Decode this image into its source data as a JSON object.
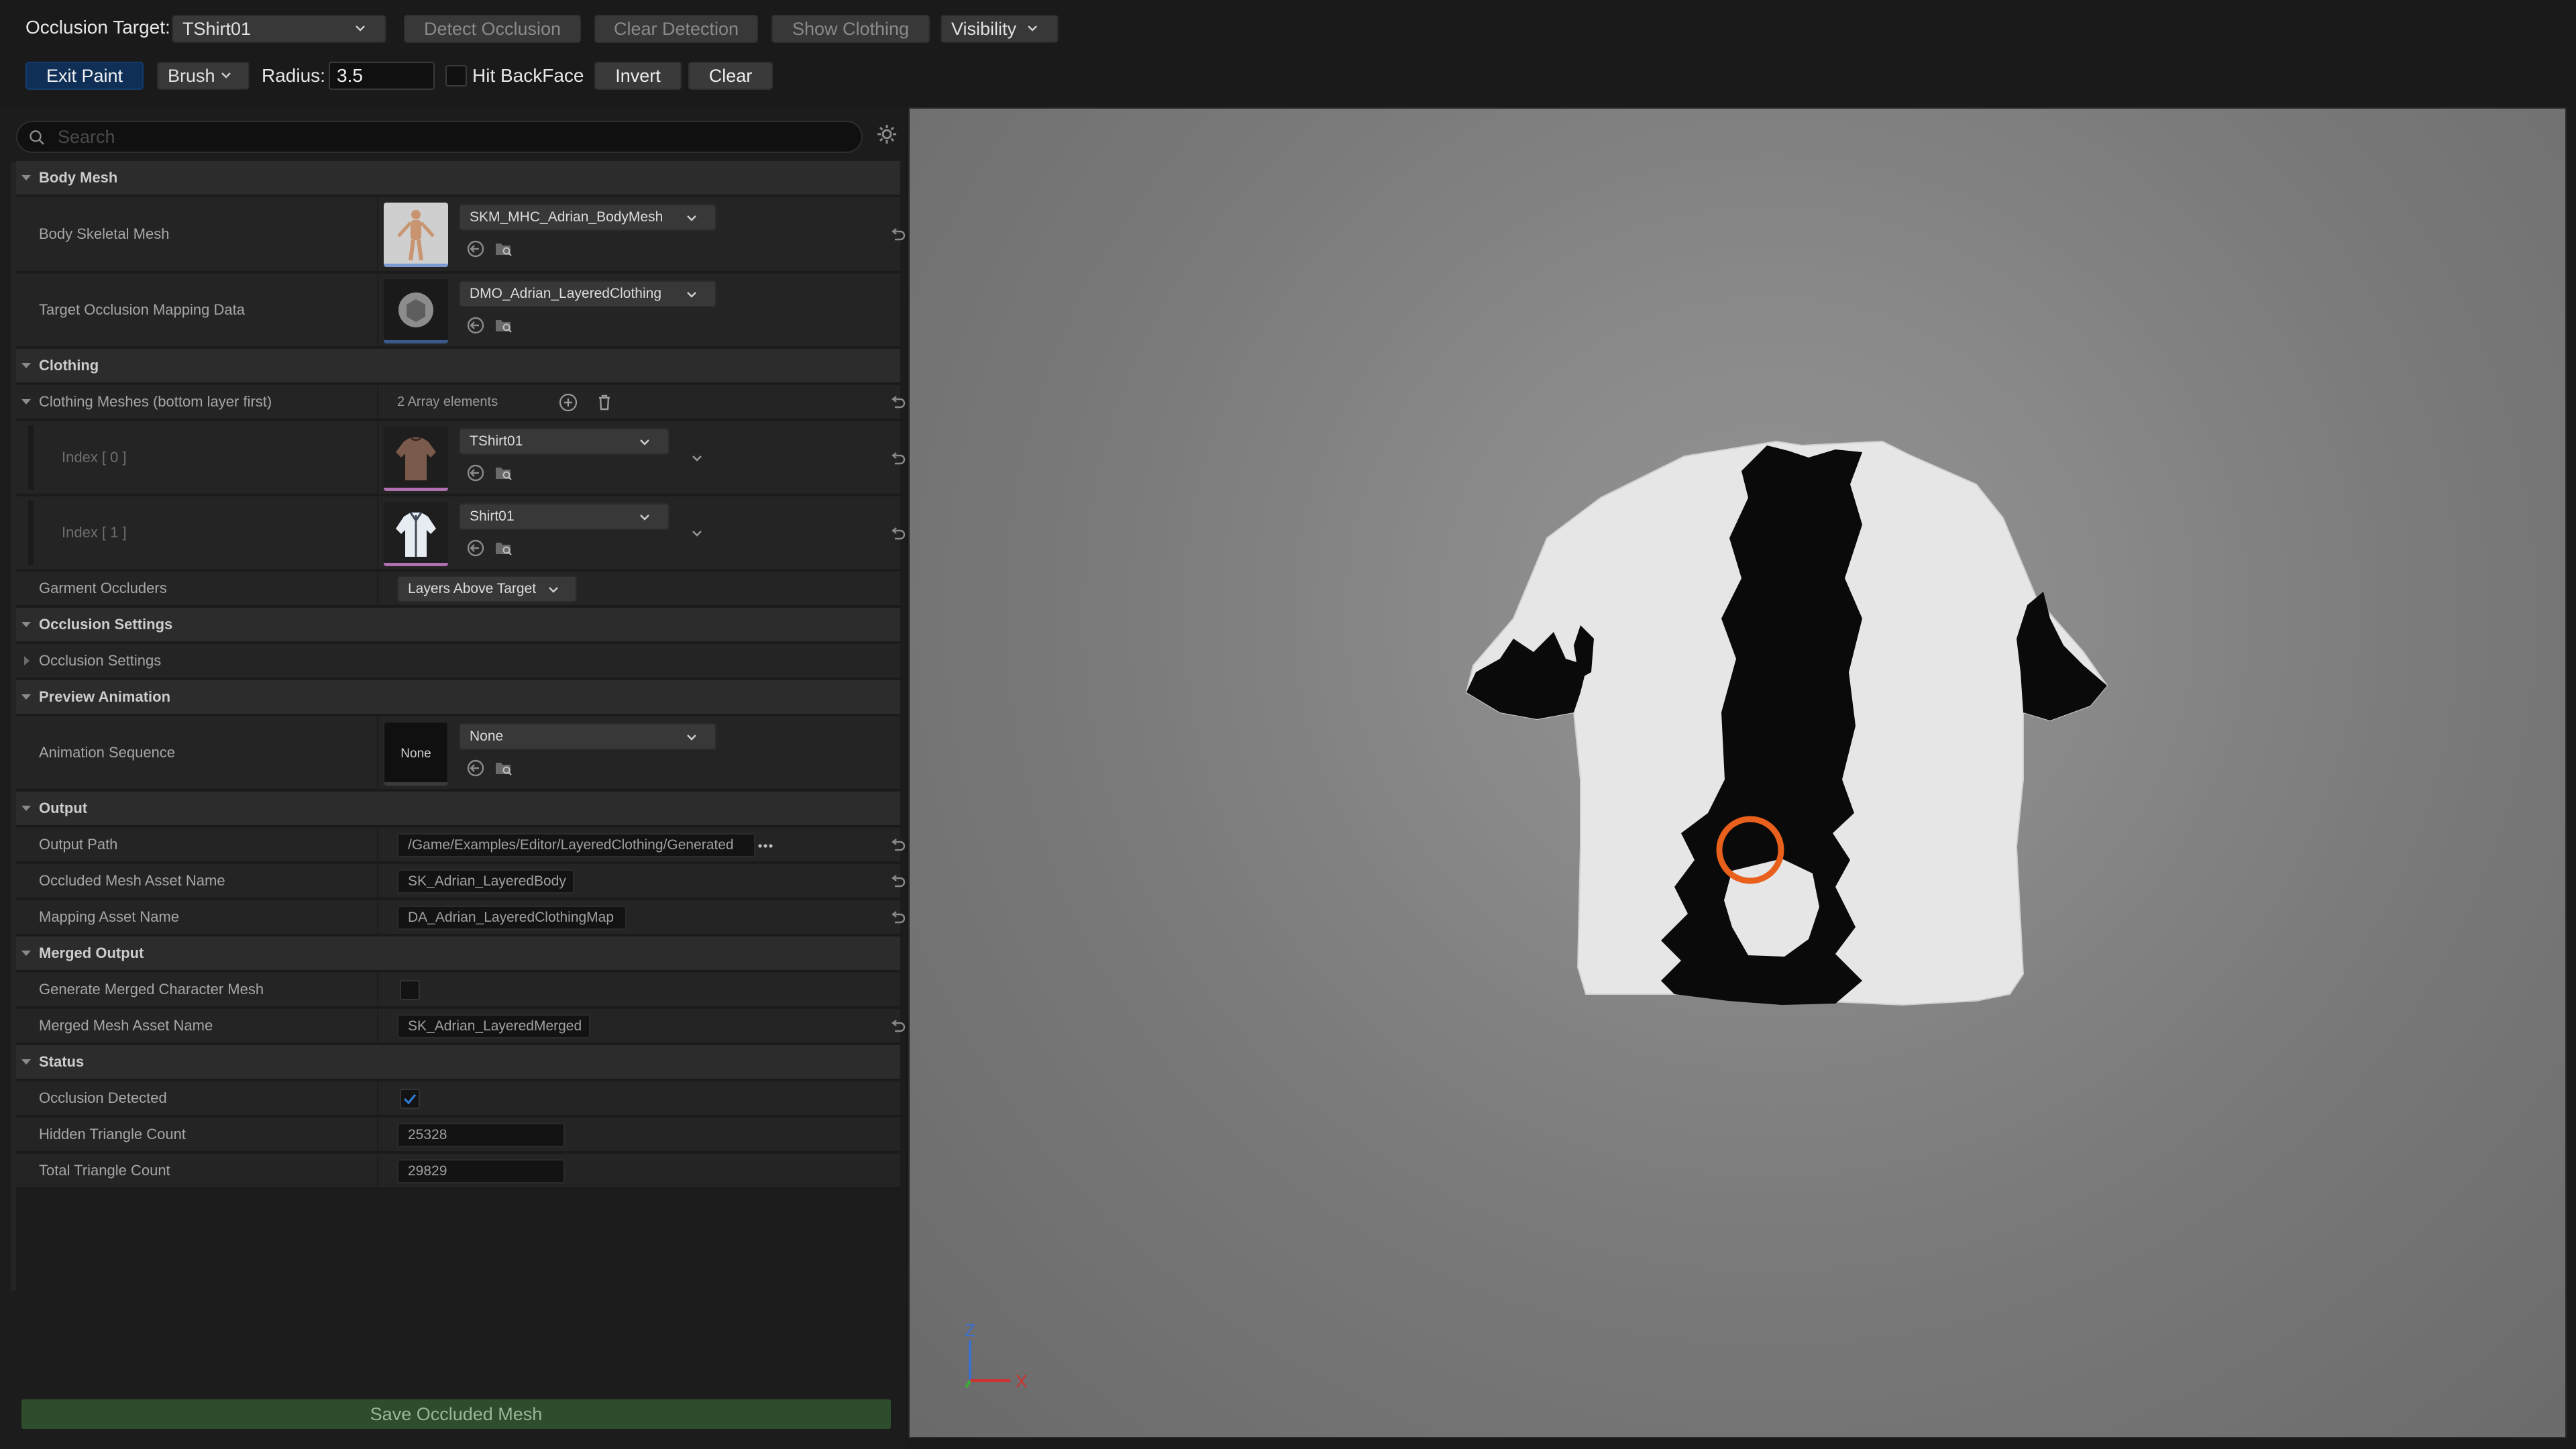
{
  "toolbar": {
    "occlusion_target_label": "Occlusion Target:",
    "occlusion_target_value": "TShirt01",
    "detect_occlusion": "Detect Occlusion",
    "clear_detection": "Clear Detection",
    "show_clothing": "Show Clothing",
    "visibility": "Visibility",
    "exit_paint": "Exit Paint",
    "brush": "Brush",
    "radius_label": "Radius:",
    "radius_value": "3.5",
    "hit_backface": "Hit BackFace",
    "invert": "Invert",
    "clear": "Clear"
  },
  "search": {
    "placeholder": "Search"
  },
  "body_mesh": {
    "section": "Body Mesh",
    "skeletal_mesh_label": "Body Skeletal Mesh",
    "skeletal_mesh_value": "SKM_MHC_Adrian_BodyMesh",
    "mapping_label": "Target Occlusion Mapping Data",
    "mapping_value": "DMO_Adrian_LayeredClothing"
  },
  "clothing": {
    "section": "Clothing",
    "meshes_label": "Clothing Meshes (bottom layer first)",
    "meshes_count": "2 Array elements",
    "items": [
      {
        "index": "Index [ 0 ]",
        "value": "TShirt01"
      },
      {
        "index": "Index [ 1 ]",
        "value": "Shirt01"
      }
    ],
    "garment_occluders_label": "Garment Occluders",
    "garment_occluders_value": "Layers Above Target"
  },
  "occlusion_settings": {
    "section": "Occlusion Settings",
    "sub_label": "Occlusion Settings"
  },
  "preview_animation": {
    "section": "Preview Animation",
    "sequence_label": "Animation Sequence",
    "thumb_text": "None",
    "sequence_value": "None"
  },
  "output": {
    "section": "Output",
    "path_label": "Output Path",
    "path_value": "/Game/Examples/Editor/LayeredClothing/Generated",
    "occluded_name_label": "Occluded Mesh Asset Name",
    "occluded_name_value": "SK_Adrian_LayeredBody",
    "mapping_name_label": "Mapping Asset Name",
    "mapping_name_value": "DA_Adrian_LayeredClothingMap"
  },
  "merged_output": {
    "section": "Merged Output",
    "generate_label": "Generate Merged Character Mesh",
    "generate_checked": false,
    "merged_name_label": "Merged Mesh Asset Name",
    "merged_name_value": "SK_Adrian_LayeredMerged"
  },
  "status": {
    "section": "Status",
    "detected_label": "Occlusion Detected",
    "detected_checked": true,
    "hidden_label": "Hidden Triangle Count",
    "hidden_value": "25328",
    "total_label": "Total Triangle Count",
    "total_value": "29829"
  },
  "save_button": "Save Occluded Mesh",
  "viewport": {
    "axis_z": "Z",
    "axis_x": "X"
  },
  "colors": {
    "accent_blue": "#0f2f57",
    "brush_cursor": "#e8601c",
    "save_green": "#2d4d2d",
    "skeletal_mesh_bar": "#7a9ad0",
    "clothing_bar": "#b070b0"
  }
}
